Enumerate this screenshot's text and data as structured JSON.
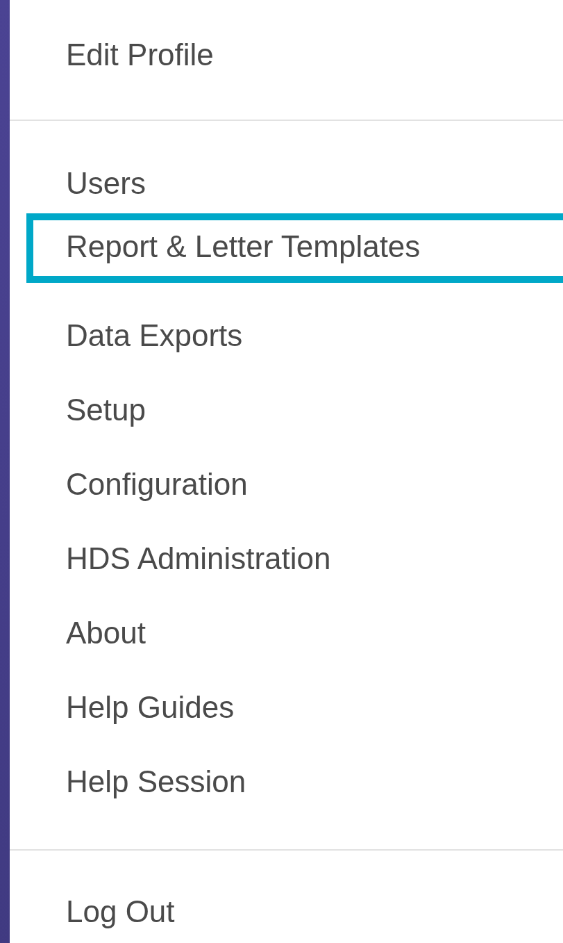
{
  "menu": {
    "sections": [
      {
        "items": [
          {
            "label": "Edit Profile",
            "highlighted": false
          }
        ]
      },
      {
        "items": [
          {
            "label": "Users",
            "highlighted": false
          },
          {
            "label": "Report & Letter Templates",
            "highlighted": true
          },
          {
            "label": "Data Exports",
            "highlighted": false
          },
          {
            "label": "Setup",
            "highlighted": false
          },
          {
            "label": "Configuration",
            "highlighted": false
          },
          {
            "label": "HDS Administration",
            "highlighted": false
          },
          {
            "label": "About",
            "highlighted": false
          },
          {
            "label": "Help Guides",
            "highlighted": false
          },
          {
            "label": "Help Session",
            "highlighted": false
          }
        ]
      },
      {
        "items": [
          {
            "label": "Log Out",
            "highlighted": false
          }
        ]
      }
    ]
  }
}
